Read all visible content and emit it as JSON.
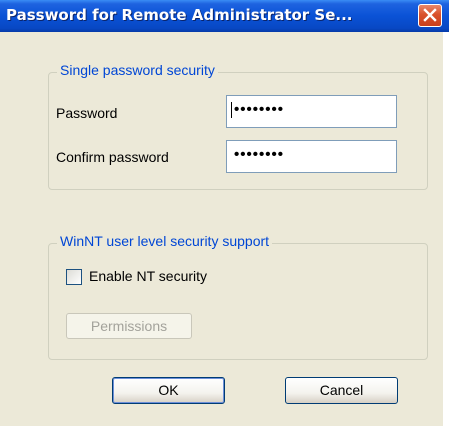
{
  "window": {
    "title": "Password for Remote Administrator Se..."
  },
  "single_password_group": {
    "label": "Single password security",
    "password_label": "Password",
    "password_value": "••••••••",
    "confirm_label": "Confirm password",
    "confirm_value": "••••••••"
  },
  "winnt_group": {
    "label": "WinNT user level security support",
    "enable_nt_label": "Enable NT security",
    "enable_nt_checked": false,
    "permissions_label": "Permissions"
  },
  "buttons": {
    "ok_label": "OK",
    "cancel_label": "Cancel"
  },
  "colors": {
    "titlebar": "#0a52d6",
    "group_label": "#0046d5",
    "dialog_bg": "#ece9d8",
    "close_button": "#d9522c"
  },
  "icons": {
    "close": "close-icon"
  }
}
